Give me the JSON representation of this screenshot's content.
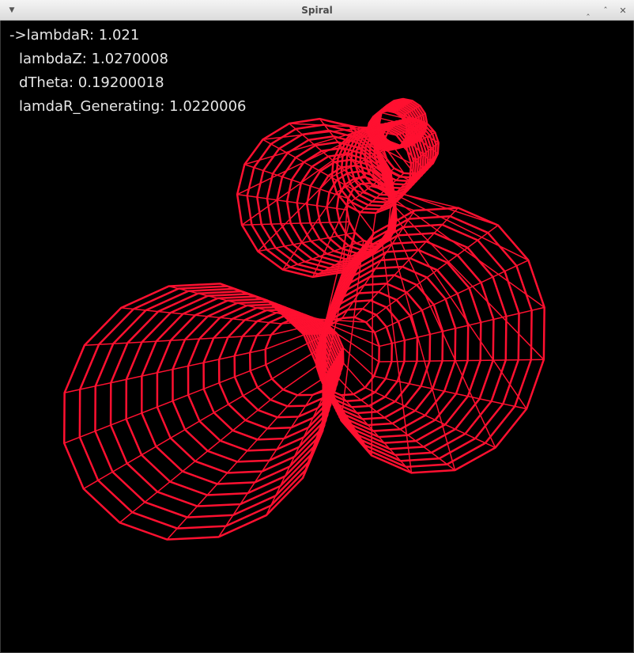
{
  "window": {
    "title": "Spiral",
    "menu_icon": "chevron-down-icon",
    "controls": [
      "minimize-icon",
      "maximize-icon",
      "close-icon"
    ]
  },
  "hud": {
    "selected_marker": "->",
    "params": [
      {
        "label": "lambdaR",
        "value": "1.021",
        "selected": true
      },
      {
        "label": "lambdaZ",
        "value": "1.0270008",
        "selected": false
      },
      {
        "label": "dTheta",
        "value": "0.19200018",
        "selected": false
      },
      {
        "label": "lamdaR_Generating",
        "value": "1.0220006",
        "selected": false
      }
    ]
  },
  "scene": {
    "background": "#000000",
    "wire_color": "#ff1030",
    "description_shape": "spiral-tube-wireframe"
  }
}
